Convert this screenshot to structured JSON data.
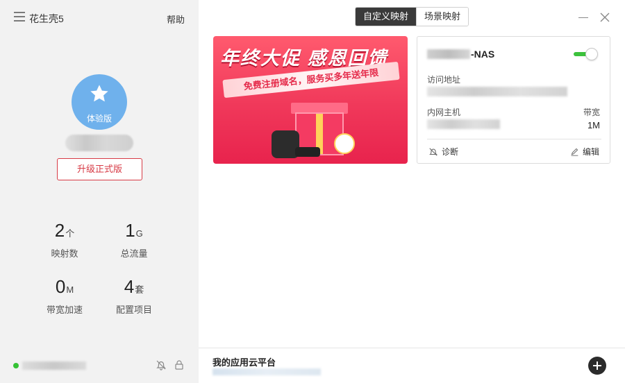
{
  "app": {
    "title": "花生壳5",
    "help": "帮助"
  },
  "account": {
    "edition": "体验版",
    "upgrade_label": "升级正式版"
  },
  "stats": [
    {
      "value": "2",
      "unit": "个",
      "label": "映射数"
    },
    {
      "value": "1",
      "unit": "G",
      "label": "总流量"
    },
    {
      "value": "0",
      "unit": "M",
      "label": "带宽加速"
    },
    {
      "value": "4",
      "unit": "套",
      "label": "配置项目"
    }
  ],
  "tabs": [
    {
      "label": "自定义映射",
      "active": true
    },
    {
      "label": "场景映射",
      "active": false
    }
  ],
  "banner": {
    "title": "年终大促 感恩回馈",
    "subtitle": "免费注册域名，服务买多年送年限"
  },
  "mapping_card": {
    "name_suffix": "-NAS",
    "enabled": true,
    "access_label": "访问地址",
    "host_label": "内网主机",
    "bandwidth_label": "带宽",
    "bandwidth_value": "1M",
    "diagnose_label": "诊断",
    "edit_label": "编辑"
  },
  "footer": {
    "title": "我的应用云平台"
  },
  "colors": {
    "accent_red": "#d73a45",
    "status_green": "#35c235",
    "avatar_blue": "#6fb1ec"
  }
}
